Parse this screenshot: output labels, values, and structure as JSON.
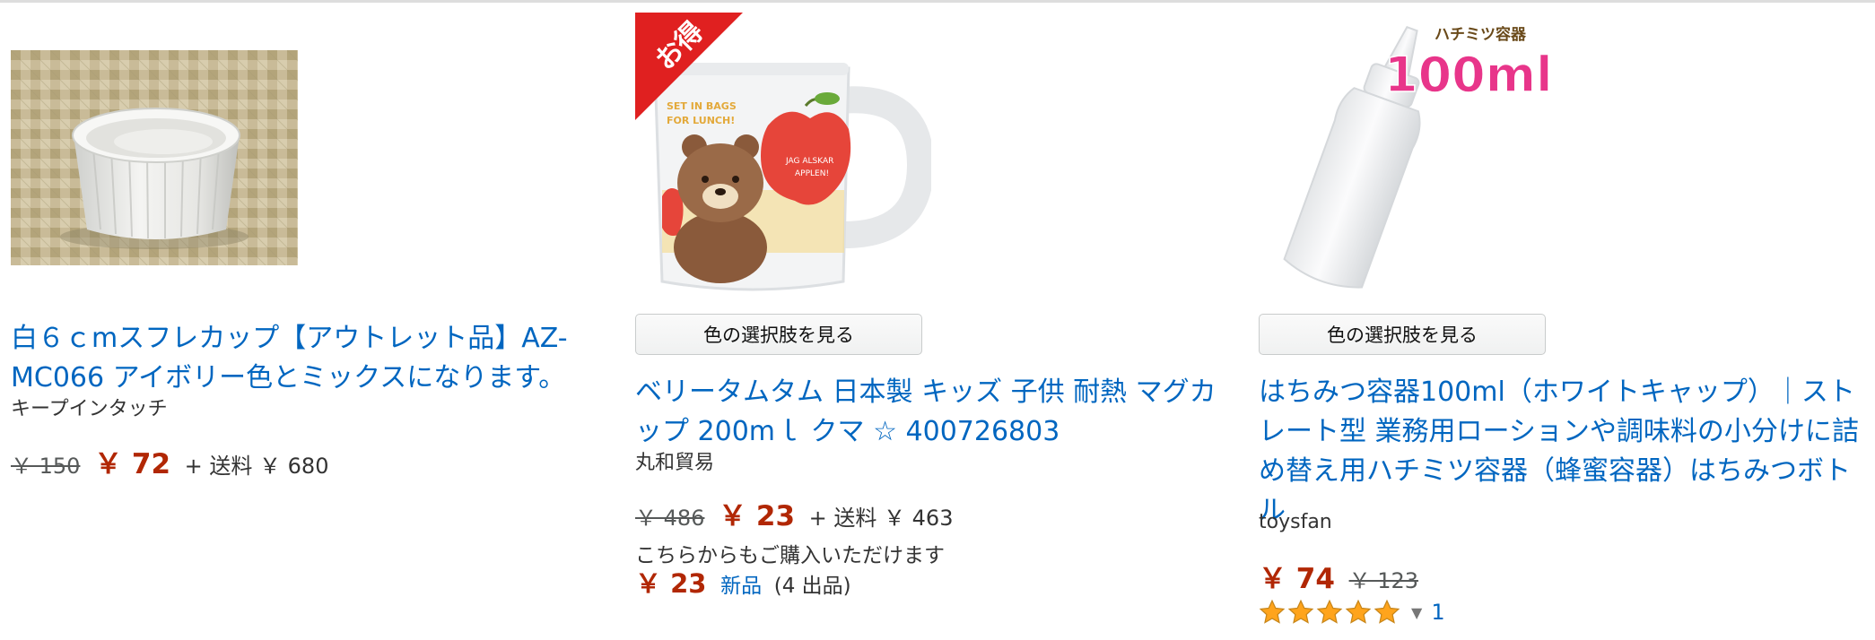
{
  "products": [
    {
      "title": "白６ｃmスフレカップ【アウトレット品】AZ-MC066 アイボリー色とミックスになります。",
      "seller": "キープインタッチ",
      "list_price": "￥ 150",
      "price": "￥ 72",
      "shipping": "+ 送料 ￥ 680"
    },
    {
      "badge": "お得",
      "cup_text_1": "SET IN BAGS FOR LUNCH!",
      "cup_text_2": "JAG ALSKAR APPLEN!",
      "variant_button": "色の選択肢を見る",
      "title": "ベリータムタム 日本製 キッズ 子供 耐熱 マグカップ 200mｌ クマ ☆ 400726803",
      "seller": "丸和貿易",
      "list_price": "￥ 486",
      "price": "￥ 23",
      "shipping": "+ 送料 ￥ 463",
      "other_offers_label": "こちらからもご購入いただけます",
      "other_offers_price": "￥ 23",
      "other_offers_condition": "新品",
      "other_offers_count": "(4 出品)"
    },
    {
      "image_caption_small": "ハチミツ容器",
      "image_caption_big": "100ml",
      "variant_button": "色の選択肢を見る",
      "title": "はちみつ容器100ml（ホワイトキャップ）｜ストレート型 業務用ローションや調味料の小分けに詰め替え用ハチミツ容器（蜂蜜容器）はちみつボトル",
      "seller": "toysfan",
      "price": "￥ 74",
      "list_price": "￥ 123",
      "rating_stars": 5,
      "rating_count": "1",
      "icons": {
        "star": "star-icon",
        "caret": "caret-down-icon"
      }
    }
  ],
  "colors": {
    "link": "#0066c0",
    "price": "#b12704",
    "star": "#ffa41c",
    "badge": "#e02020"
  }
}
